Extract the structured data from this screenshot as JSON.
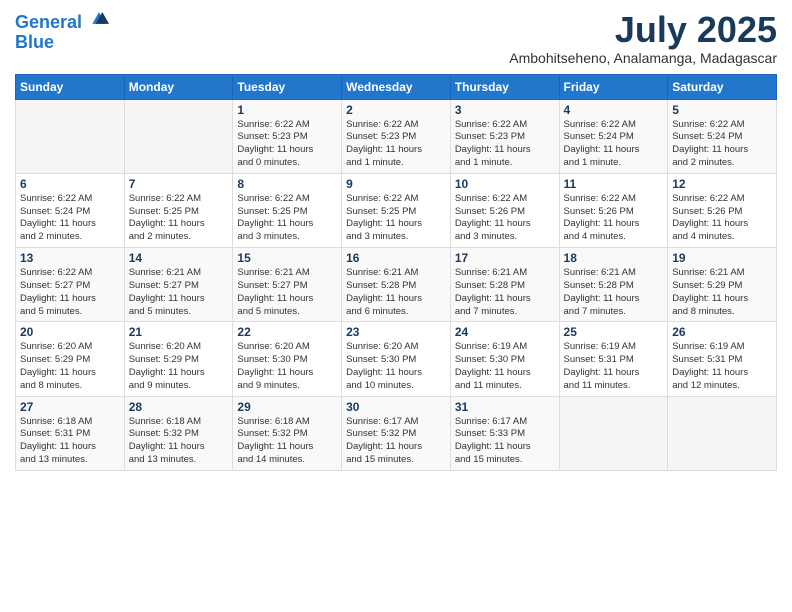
{
  "logo": {
    "line1": "General",
    "line2": "Blue"
  },
  "title": "July 2025",
  "location": "Ambohitseheno, Analamanga, Madagascar",
  "weekdays": [
    "Sunday",
    "Monday",
    "Tuesday",
    "Wednesday",
    "Thursday",
    "Friday",
    "Saturday"
  ],
  "weeks": [
    [
      {
        "day": "",
        "info": ""
      },
      {
        "day": "",
        "info": ""
      },
      {
        "day": "1",
        "info": "Sunrise: 6:22 AM\nSunset: 5:23 PM\nDaylight: 11 hours\nand 0 minutes."
      },
      {
        "day": "2",
        "info": "Sunrise: 6:22 AM\nSunset: 5:23 PM\nDaylight: 11 hours\nand 1 minute."
      },
      {
        "day": "3",
        "info": "Sunrise: 6:22 AM\nSunset: 5:23 PM\nDaylight: 11 hours\nand 1 minute."
      },
      {
        "day": "4",
        "info": "Sunrise: 6:22 AM\nSunset: 5:24 PM\nDaylight: 11 hours\nand 1 minute."
      },
      {
        "day": "5",
        "info": "Sunrise: 6:22 AM\nSunset: 5:24 PM\nDaylight: 11 hours\nand 2 minutes."
      }
    ],
    [
      {
        "day": "6",
        "info": "Sunrise: 6:22 AM\nSunset: 5:24 PM\nDaylight: 11 hours\nand 2 minutes."
      },
      {
        "day": "7",
        "info": "Sunrise: 6:22 AM\nSunset: 5:25 PM\nDaylight: 11 hours\nand 2 minutes."
      },
      {
        "day": "8",
        "info": "Sunrise: 6:22 AM\nSunset: 5:25 PM\nDaylight: 11 hours\nand 3 minutes."
      },
      {
        "day": "9",
        "info": "Sunrise: 6:22 AM\nSunset: 5:25 PM\nDaylight: 11 hours\nand 3 minutes."
      },
      {
        "day": "10",
        "info": "Sunrise: 6:22 AM\nSunset: 5:26 PM\nDaylight: 11 hours\nand 3 minutes."
      },
      {
        "day": "11",
        "info": "Sunrise: 6:22 AM\nSunset: 5:26 PM\nDaylight: 11 hours\nand 4 minutes."
      },
      {
        "day": "12",
        "info": "Sunrise: 6:22 AM\nSunset: 5:26 PM\nDaylight: 11 hours\nand 4 minutes."
      }
    ],
    [
      {
        "day": "13",
        "info": "Sunrise: 6:22 AM\nSunset: 5:27 PM\nDaylight: 11 hours\nand 5 minutes."
      },
      {
        "day": "14",
        "info": "Sunrise: 6:21 AM\nSunset: 5:27 PM\nDaylight: 11 hours\nand 5 minutes."
      },
      {
        "day": "15",
        "info": "Sunrise: 6:21 AM\nSunset: 5:27 PM\nDaylight: 11 hours\nand 5 minutes."
      },
      {
        "day": "16",
        "info": "Sunrise: 6:21 AM\nSunset: 5:28 PM\nDaylight: 11 hours\nand 6 minutes."
      },
      {
        "day": "17",
        "info": "Sunrise: 6:21 AM\nSunset: 5:28 PM\nDaylight: 11 hours\nand 7 minutes."
      },
      {
        "day": "18",
        "info": "Sunrise: 6:21 AM\nSunset: 5:28 PM\nDaylight: 11 hours\nand 7 minutes."
      },
      {
        "day": "19",
        "info": "Sunrise: 6:21 AM\nSunset: 5:29 PM\nDaylight: 11 hours\nand 8 minutes."
      }
    ],
    [
      {
        "day": "20",
        "info": "Sunrise: 6:20 AM\nSunset: 5:29 PM\nDaylight: 11 hours\nand 8 minutes."
      },
      {
        "day": "21",
        "info": "Sunrise: 6:20 AM\nSunset: 5:29 PM\nDaylight: 11 hours\nand 9 minutes."
      },
      {
        "day": "22",
        "info": "Sunrise: 6:20 AM\nSunset: 5:30 PM\nDaylight: 11 hours\nand 9 minutes."
      },
      {
        "day": "23",
        "info": "Sunrise: 6:20 AM\nSunset: 5:30 PM\nDaylight: 11 hours\nand 10 minutes."
      },
      {
        "day": "24",
        "info": "Sunrise: 6:19 AM\nSunset: 5:30 PM\nDaylight: 11 hours\nand 11 minutes."
      },
      {
        "day": "25",
        "info": "Sunrise: 6:19 AM\nSunset: 5:31 PM\nDaylight: 11 hours\nand 11 minutes."
      },
      {
        "day": "26",
        "info": "Sunrise: 6:19 AM\nSunset: 5:31 PM\nDaylight: 11 hours\nand 12 minutes."
      }
    ],
    [
      {
        "day": "27",
        "info": "Sunrise: 6:18 AM\nSunset: 5:31 PM\nDaylight: 11 hours\nand 13 minutes."
      },
      {
        "day": "28",
        "info": "Sunrise: 6:18 AM\nSunset: 5:32 PM\nDaylight: 11 hours\nand 13 minutes."
      },
      {
        "day": "29",
        "info": "Sunrise: 6:18 AM\nSunset: 5:32 PM\nDaylight: 11 hours\nand 14 minutes."
      },
      {
        "day": "30",
        "info": "Sunrise: 6:17 AM\nSunset: 5:32 PM\nDaylight: 11 hours\nand 15 minutes."
      },
      {
        "day": "31",
        "info": "Sunrise: 6:17 AM\nSunset: 5:33 PM\nDaylight: 11 hours\nand 15 minutes."
      },
      {
        "day": "",
        "info": ""
      },
      {
        "day": "",
        "info": ""
      }
    ]
  ]
}
